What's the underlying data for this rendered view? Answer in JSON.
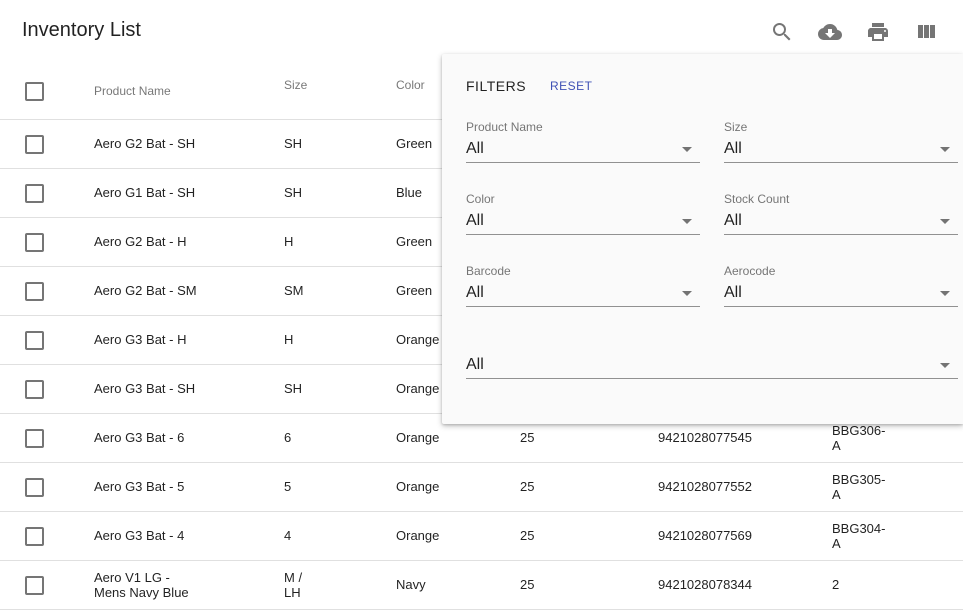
{
  "page": {
    "title": "Inventory List"
  },
  "toolbar": {
    "icons": [
      "search-icon",
      "cloud-download-icon",
      "print-icon",
      "view-column-icon"
    ]
  },
  "table": {
    "columns": [
      "Product Name",
      "Size",
      "Color"
    ],
    "rows": [
      {
        "name": "Aero G2 Bat - SH",
        "size": "SH",
        "color": "Green",
        "stock": "",
        "barcode": "",
        "aerocode": ""
      },
      {
        "name": "Aero G1 Bat - SH",
        "size": "SH",
        "color": "Blue",
        "stock": "",
        "barcode": "",
        "aerocode": ""
      },
      {
        "name": "Aero G2 Bat - H",
        "size": "H",
        "color": "Green",
        "stock": "",
        "barcode": "",
        "aerocode": ""
      },
      {
        "name": "Aero G2 Bat - SM",
        "size": "SM",
        "color": "Green",
        "stock": "",
        "barcode": "",
        "aerocode": ""
      },
      {
        "name": "Aero G3 Bat - H",
        "size": "H",
        "color": "Orange",
        "stock": "",
        "barcode": "",
        "aerocode": ""
      },
      {
        "name": "Aero G3 Bat - SH",
        "size": "SH",
        "color": "Orange",
        "stock": "",
        "barcode": "",
        "aerocode": ""
      },
      {
        "name": "Aero G3 Bat - 6",
        "size": "6",
        "color": "Orange",
        "stock": "25",
        "barcode": "9421028077545",
        "aerocode": "BBG306-\nA"
      },
      {
        "name": "Aero G3 Bat - 5",
        "size": "5",
        "color": "Orange",
        "stock": "25",
        "barcode": "9421028077552",
        "aerocode": "BBG305-\nA"
      },
      {
        "name": "Aero G3 Bat - 4",
        "size": "4",
        "color": "Orange",
        "stock": "25",
        "barcode": "9421028077569",
        "aerocode": "BBG304-\nA"
      },
      {
        "name": "Aero V1 LG -\nMens Navy Blue",
        "size": "M /\nLH",
        "color": "Navy",
        "stock": "25",
        "barcode": "9421028078344",
        "aerocode": "2"
      }
    ]
  },
  "filters": {
    "title": "FILTERS",
    "reset_label": "RESET",
    "fields": [
      {
        "label": "Product Name",
        "value": "All"
      },
      {
        "label": "Size",
        "value": "All"
      },
      {
        "label": "Color",
        "value": "All"
      },
      {
        "label": "Stock Count",
        "value": "All"
      },
      {
        "label": "Barcode",
        "value": "All"
      },
      {
        "label": "Aerocode",
        "value": "All"
      },
      {
        "label": "",
        "value": "All"
      }
    ]
  },
  "colors": {
    "accent": "#3f51b5",
    "divider": "#e0e0e0",
    "panel": "#fafafa"
  }
}
